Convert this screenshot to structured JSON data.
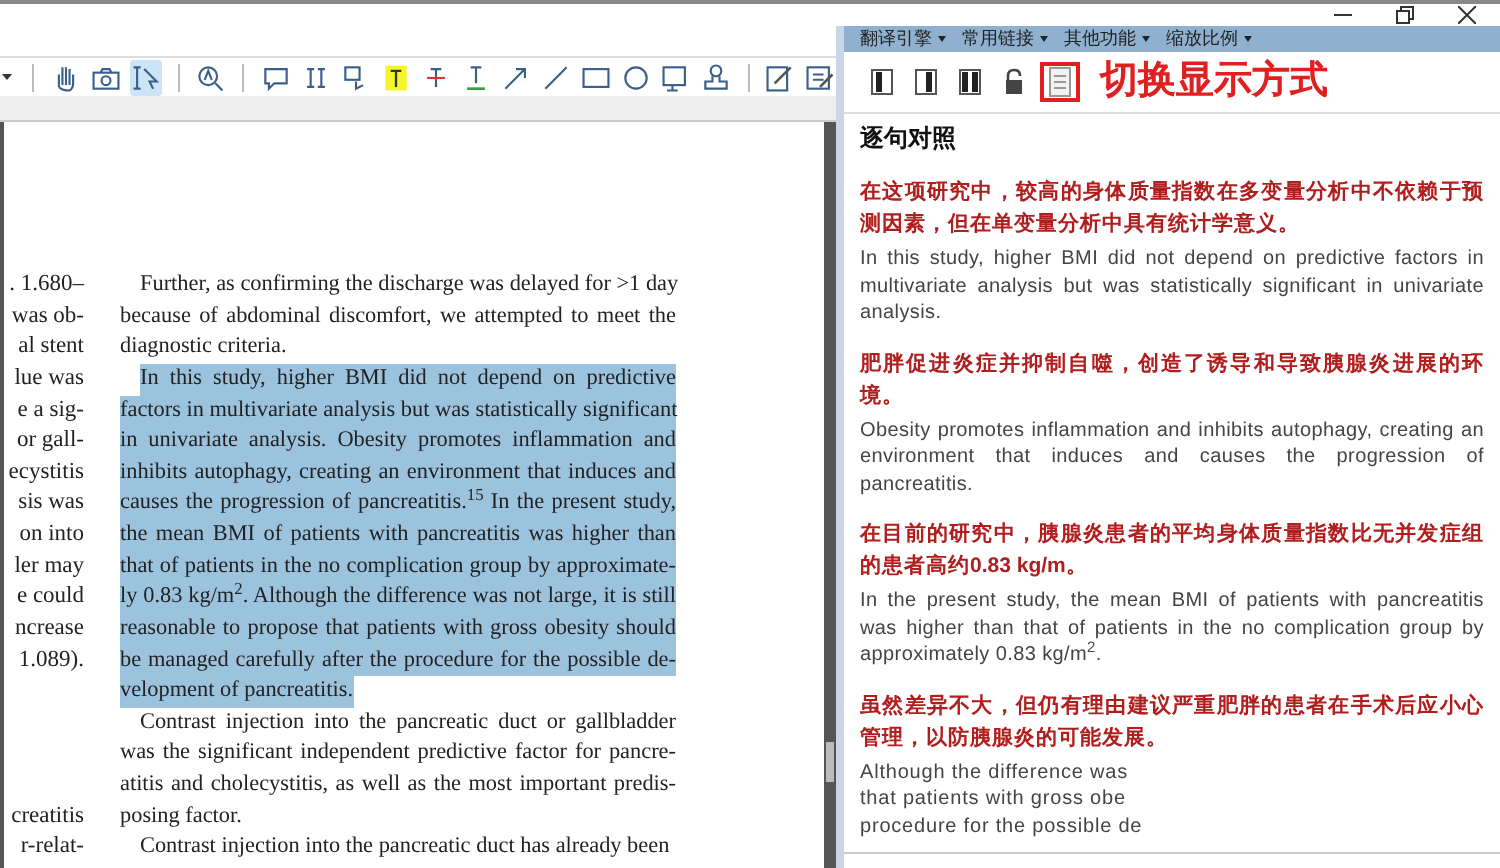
{
  "toolbar": {
    "tools": [
      {
        "kind": "hand",
        "selected": false
      },
      {
        "kind": "camera",
        "selected": false
      },
      {
        "kind": "select",
        "selected": true
      },
      {
        "kind": "sep"
      },
      {
        "kind": "zoom",
        "selected": false
      },
      {
        "kind": "sep"
      },
      {
        "kind": "note",
        "selected": false
      },
      {
        "kind": "textselect",
        "selected": false
      },
      {
        "kind": "replace",
        "selected": false
      },
      {
        "kind": "highlight",
        "selected": false
      },
      {
        "kind": "strike",
        "selected": false
      },
      {
        "kind": "underline",
        "selected": false
      },
      {
        "kind": "arrow",
        "selected": false
      },
      {
        "kind": "line",
        "selected": false
      },
      {
        "kind": "rect",
        "selected": false
      },
      {
        "kind": "oval",
        "selected": false
      },
      {
        "kind": "image",
        "selected": false
      },
      {
        "kind": "stamp",
        "selected": false
      },
      {
        "kind": "sep"
      },
      {
        "kind": "edit",
        "selected": false
      },
      {
        "kind": "form",
        "selected": false
      }
    ]
  },
  "document": {
    "margin_fragments": [
      [
        ". 1.680–",
        "was ob-",
        "al stent",
        "lue was",
        "e a sig-",
        "or gall-",
        "ecystitis",
        "sis was",
        "on into",
        "ler may",
        "e could",
        "ncrease",
        "1.089)."
      ],
      [
        "creatitis",
        "r-relat-"
      ]
    ],
    "paragraphs": [
      {
        "highlighted": false,
        "lines": [
          "Further, as confirming the discharge was delayed for >1 day",
          "because of abdominal discomfort, we attempted to meet the",
          "diagnostic criteria."
        ]
      },
      {
        "highlighted": true,
        "lines": [
          "In this study, higher BMI did not depend on predictive",
          "factors in multivariate analysis but was statistically significant",
          "in univariate analysis. Obesity promotes inflammation and",
          "inhibits autophagy, creating an environment that induces and",
          "causes the progression of pancreatitis.$^{15}$ In the present study,",
          "the mean BMI of patients with pancreatitis was higher than",
          "that of patients in the no complication group by approximate-",
          "ly 0.83 kg/m$^{2}$. Although the difference was not large, it is still",
          "reasonable to propose that patients with gross obesity should",
          "be managed carefully after the procedure for the possible de-",
          "velopment of pancreatitis."
        ]
      },
      {
        "highlighted": false,
        "lines": [
          "Contrast injection into the pancreatic duct or gallbladder",
          "was the significant independent predictive factor for pancre-",
          "atitis and cholecystitis, as well as the most important predis-",
          "posing factor."
        ]
      },
      {
        "highlighted": false,
        "lines": [
          "Contrast injection into the pancreatic duct has already been"
        ]
      }
    ]
  },
  "translator": {
    "menus": [
      "翻译引擎",
      "常用链接",
      "其他功能",
      "缩放比例"
    ],
    "view_buttons": [
      {
        "kind": "left",
        "framed": false
      },
      {
        "kind": "right",
        "framed": false
      },
      {
        "kind": "both",
        "framed": false
      },
      {
        "kind": "lock",
        "framed": false
      },
      {
        "kind": "page",
        "framed": true
      }
    ],
    "annotation": "切换显示方式",
    "heading": "逐句对照",
    "pairs": [
      {
        "chinese": "在这项研究中，较高的身体质量指数在多变量分析中不依赖于预测因素，但在单变量分析中具有统计学意义。",
        "english": [
          "In this study, higher BMI did not depend on predictive factors in multivariate analysis but was statistically significant in univariate analysis."
        ]
      },
      {
        "chinese": "肥胖促进炎症并抑制自噬，创造了诱导和导致胰腺炎进展的环境。",
        "english": [
          "Obesity promotes inflammation and inhibits autophagy, creating an environment that induces and causes the progression of pancreatitis."
        ]
      },
      {
        "chinese": "在目前的研究中，胰腺炎患者的平均身体质量指数比无并发症组的患者高约0.83 kg/m。",
        "english": [
          "In the present study, the mean BMI of patients with pancreatitis was higher than that of patients in the no complication group by approximately 0.83 kg/m$^{2}$."
        ]
      },
      {
        "chinese": "虽然差异不大，但仍有理由建议严重肥胖的患者在手术后应小心管理，以防胰腺炎的可能发展。",
        "english": [
          "Although the difference was",
          "that patients with gross obe",
          "procedure for the possible de"
        ]
      }
    ]
  }
}
